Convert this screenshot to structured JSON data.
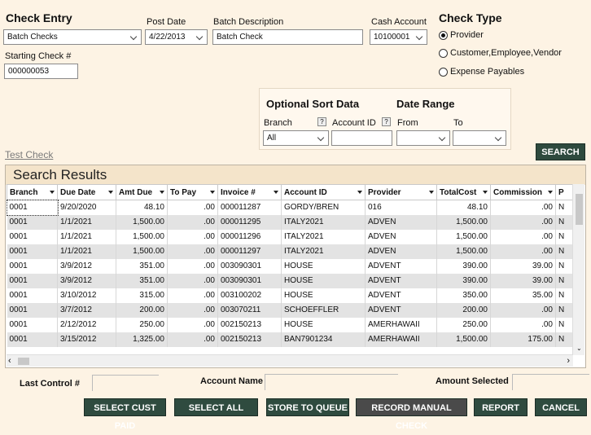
{
  "header": {
    "title": "Check Entry",
    "post_date_label": "Post Date",
    "batch_desc_label": "Batch Description",
    "cash_account_label": "Cash Account",
    "check_type_label": "Check Type"
  },
  "fields": {
    "batch_type": "Batch Checks",
    "post_date": "4/22/2013",
    "batch_description": "Batch Check",
    "cash_account": "10100001",
    "starting_check_label": "Starting Check #",
    "starting_check": "000000053"
  },
  "check_type": {
    "options": [
      "Provider",
      "Customer,Employee,Vendor",
      "Expense Payables"
    ],
    "selected": "Provider"
  },
  "sort": {
    "title": "Optional Sort Data",
    "date_range_title": "Date Range",
    "branch_label": "Branch",
    "branch_value": "All",
    "account_id_label": "Account ID",
    "from_label": "From",
    "to_label": "To",
    "help": "?"
  },
  "links": {
    "test_check": "Test Check"
  },
  "buttons": {
    "search": "SEARCH",
    "select_cust_paid": "SELECT CUST PAID",
    "select_all": "SELECT ALL",
    "store_to_queue": "STORE TO QUEUE",
    "record_manual_check": "RECORD MANUAL CHECK",
    "report": "REPORT",
    "cancel": "CANCEL"
  },
  "results": {
    "title": "Search Results",
    "columns": [
      "Branch",
      "Due Date",
      "Amt Due",
      "To Pay",
      "Invoice #",
      "Account ID",
      "Provider",
      "TotalCost",
      "Commission",
      "P"
    ],
    "rows": [
      [
        "0001",
        "9/20/2020",
        "48.10",
        ".00",
        "000011287",
        "GORDY/BREN",
        "016",
        "48.10",
        ".00",
        "N"
      ],
      [
        "0001",
        "1/1/2021",
        "1,500.00",
        ".00",
        "000011295",
        "ITALY2021",
        "ADVEN",
        "1,500.00",
        ".00",
        "N"
      ],
      [
        "0001",
        "1/1/2021",
        "1,500.00",
        ".00",
        "000011296",
        "ITALY2021",
        "ADVEN",
        "1,500.00",
        ".00",
        "N"
      ],
      [
        "0001",
        "1/1/2021",
        "1,500.00",
        ".00",
        "000011297",
        "ITALY2021",
        "ADVEN",
        "1,500.00",
        ".00",
        "N"
      ],
      [
        "0001",
        "3/9/2012",
        "351.00",
        ".00",
        "003090301",
        "HOUSE",
        "ADVENT",
        "390.00",
        "39.00",
        "N"
      ],
      [
        "0001",
        "3/9/2012",
        "351.00",
        ".00",
        "003090301",
        "HOUSE",
        "ADVENT",
        "390.00",
        "39.00",
        "N"
      ],
      [
        "0001",
        "3/10/2012",
        "315.00",
        ".00",
        "003100202",
        "HOUSE",
        "ADVENT",
        "350.00",
        "35.00",
        "N"
      ],
      [
        "0001",
        "3/7/2012",
        "200.00",
        ".00",
        "003070211",
        "SCHOEFFLER",
        "ADVENT",
        "200.00",
        ".00",
        "N"
      ],
      [
        "0001",
        "2/12/2012",
        "250.00",
        ".00",
        "002150213",
        "HOUSE",
        "AMERHAWAII",
        "250.00",
        ".00",
        "N"
      ],
      [
        "0001",
        "3/15/2012",
        "1,325.00",
        ".00",
        "002150213",
        "BAN7901234",
        "AMERHAWAII",
        "1,500.00",
        "175.00",
        "N"
      ]
    ]
  },
  "footer": {
    "last_control_label": "Last Control #",
    "account_name_label": "Account Name",
    "amount_selected_label": "Amount Selected"
  }
}
